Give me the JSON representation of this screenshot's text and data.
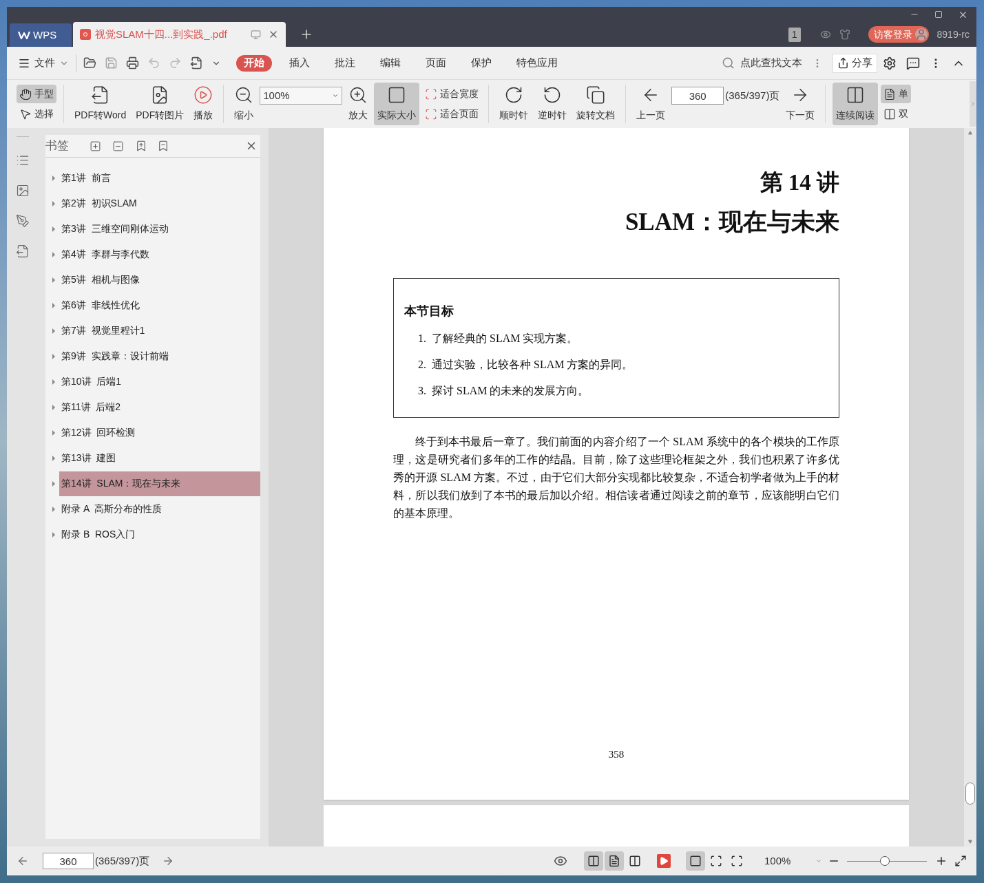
{
  "tabs": [
    {
      "label": "WPS",
      "kind": "app",
      "selected": false
    },
    {
      "label": "视觉SLAM十四...到实践_.pdf",
      "kind": "document",
      "selected": true
    }
  ],
  "title_bar": {
    "badge": "1",
    "login": "访客登录",
    "user": "8919-rc"
  },
  "menu": {
    "file": "文件",
    "tabs": [
      {
        "label": "开始",
        "selected": true
      },
      {
        "label": "插入",
        "selected": false
      },
      {
        "label": "批注",
        "selected": false
      },
      {
        "label": "编辑",
        "selected": false
      },
      {
        "label": "页面",
        "selected": false
      },
      {
        "label": "保护",
        "selected": false
      },
      {
        "label": "特色应用",
        "selected": false
      }
    ],
    "search_placeholder": "点此查找文本",
    "share": "分享"
  },
  "toolbar": [
    {
      "kind": "pair",
      "items": [
        {
          "label": "手型",
          "selected": true
        },
        {
          "label": "选择",
          "selected": false
        }
      ]
    },
    {
      "kind": "large",
      "label": "PDF转Word",
      "selected": false
    },
    {
      "kind": "large",
      "label": "PDF转图片",
      "selected": false
    },
    {
      "kind": "large",
      "label": "播放",
      "selected": false
    },
    {
      "kind": "large",
      "label": "缩小",
      "selected": false
    },
    {
      "kind": "zoom",
      "value": "100%"
    },
    {
      "kind": "large",
      "label": "放大",
      "selected": false
    },
    {
      "kind": "large",
      "label": "实际大小",
      "selected": true
    },
    {
      "kind": "pair",
      "items": [
        {
          "label": "适合宽度",
          "selected": false
        },
        {
          "label": "适合页面",
          "selected": false
        }
      ]
    },
    {
      "kind": "large",
      "label": "顺时针",
      "selected": false
    },
    {
      "kind": "large",
      "label": "逆时针",
      "selected": false
    },
    {
      "kind": "large",
      "label": "旋转文档",
      "selected": false
    },
    {
      "kind": "large",
      "label": "上一页",
      "selected": false
    },
    {
      "kind": "page",
      "value": "360",
      "total": "(365/397)页"
    },
    {
      "kind": "large",
      "label": "下一页",
      "selected": false
    },
    {
      "kind": "large",
      "label": "连续阅读",
      "selected": true
    },
    {
      "kind": "pair",
      "items": [
        {
          "label": "单",
          "selected": true
        },
        {
          "label": "双",
          "selected": false
        }
      ]
    }
  ],
  "sidebar": {
    "title": "书签",
    "bookmarks": [
      {
        "label": "第1讲  前言",
        "selected": false
      },
      {
        "label": "第2讲  初识SLAM",
        "selected": false
      },
      {
        "label": "第3讲  三维空间刚体运动",
        "selected": false
      },
      {
        "label": "第4讲  李群与李代数",
        "selected": false
      },
      {
        "label": "第5讲  相机与图像",
        "selected": false
      },
      {
        "label": "第6讲  非线性优化",
        "selected": false
      },
      {
        "label": "第7讲  视觉里程计1",
        "selected": false
      },
      {
        "label": "第9讲  实践章：设计前端",
        "selected": false
      },
      {
        "label": "第10讲  后端1",
        "selected": false
      },
      {
        "label": "第11讲  后端2",
        "selected": false
      },
      {
        "label": "第12讲  回环检测",
        "selected": false
      },
      {
        "label": "第13讲  建图",
        "selected": false
      },
      {
        "label": "第14讲  SLAM：现在与未来",
        "selected": true
      },
      {
        "label": "附录 A  高斯分布的性质",
        "selected": false
      },
      {
        "label": "附录 B  ROS入门",
        "selected": false
      }
    ]
  },
  "document": {
    "chapter": "第 14 讲",
    "title": "SLAM：现在与未来",
    "goals_title": "本节目标",
    "goals": [
      {
        "number": "1.",
        "text": "了解经典的 SLAM 实现方案。"
      },
      {
        "number": "2.",
        "text": "通过实验，比较各种 SLAM 方案的异同。"
      },
      {
        "number": "3.",
        "text": "探讨 SLAM 的未来的发展方向。"
      }
    ],
    "paragraph": "终于到本书最后一章了。我们前面的内容介绍了一个 SLAM 系统中的各个模块的工作原理，这是研究者们多年的工作的结晶。目前，除了这些理论框架之外，我们也积累了许多优秀的开源 SLAM 方案。不过，由于它们大部分实现都比较复杂，不适合初学者做为上手的材料，所以我们放到了本书的最后加以介绍。相信读者通过阅读之前的章节，应该能明白它们的基本原理。",
    "page_number": "358"
  },
  "status_bar": {
    "page": "360",
    "total": "(365/397)页",
    "views": [
      {
        "kind": "continuous",
        "selected": true
      },
      {
        "kind": "single",
        "selected": true
      },
      {
        "kind": "double",
        "selected": false
      }
    ],
    "fits": [
      {
        "kind": "actual",
        "selected": true
      },
      {
        "kind": "page",
        "selected": false
      },
      {
        "kind": "width",
        "selected": false
      }
    ],
    "zoom": "100%",
    "level": 0.47
  }
}
